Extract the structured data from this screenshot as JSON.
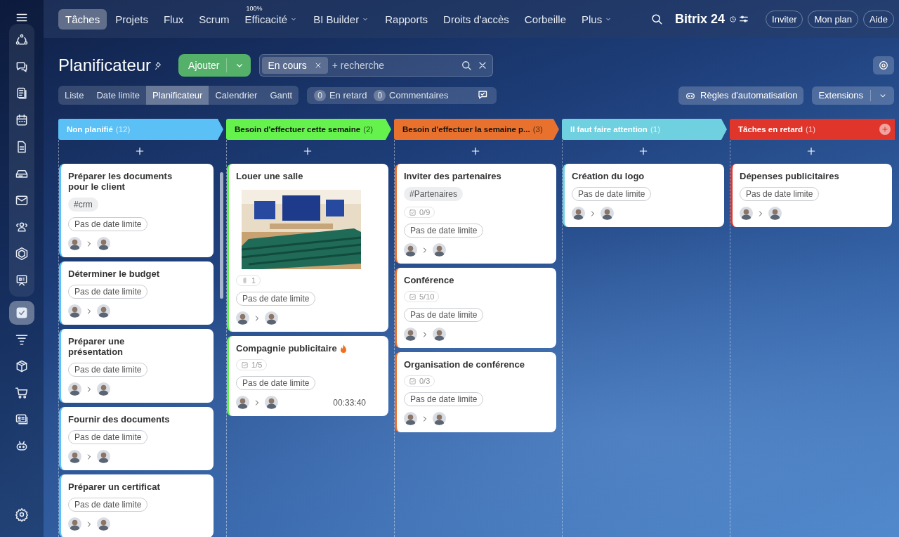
{
  "sidebar": {
    "items": [
      {
        "selected": false
      },
      {
        "selected": false
      },
      {
        "selected": false
      },
      {
        "selected": false
      },
      {
        "selected": false
      },
      {
        "selected": false
      },
      {
        "selected": false
      },
      {
        "selected": false
      },
      {
        "selected": false
      },
      {
        "selected": false
      },
      {
        "selected": true
      },
      {
        "selected": false
      },
      {
        "selected": false
      },
      {
        "selected": false
      },
      {
        "selected": false
      },
      {
        "selected": false
      }
    ]
  },
  "top_nav": {
    "items": [
      {
        "label": "Tâches",
        "selected": true,
        "dropdown": false
      },
      {
        "label": "Projets",
        "selected": false,
        "dropdown": false
      },
      {
        "label": "Flux",
        "selected": false,
        "dropdown": false
      },
      {
        "label": "Scrum",
        "selected": false,
        "dropdown": false
      },
      {
        "label": "Efficacité",
        "selected": false,
        "dropdown": true,
        "badge": "100%"
      },
      {
        "label": "BI Builder",
        "selected": false,
        "dropdown": true
      },
      {
        "label": "Rapports",
        "selected": false,
        "dropdown": false
      },
      {
        "label": "Droits d'accès",
        "selected": false,
        "dropdown": false
      },
      {
        "label": "Corbeille",
        "selected": false,
        "dropdown": false
      },
      {
        "label": "Plus",
        "selected": false,
        "dropdown": true
      }
    ],
    "logo": "Bitrix 24",
    "buttons": [
      "Inviter",
      "Mon plan",
      "Aide"
    ]
  },
  "header": {
    "title": "Planificateur",
    "add_button": "Ajouter",
    "search": {
      "chip": "En cours",
      "placeholder": "+ recherche"
    }
  },
  "view_tabs": [
    {
      "label": "Liste",
      "selected": false
    },
    {
      "label": "Date limite",
      "selected": false
    },
    {
      "label": "Planificateur",
      "selected": true
    },
    {
      "label": "Calendrier",
      "selected": false
    },
    {
      "label": "Gantt",
      "selected": false
    }
  ],
  "counters": [
    {
      "count": "0",
      "label": "En retard"
    },
    {
      "count": "0",
      "label": "Commentaires"
    }
  ],
  "automation_button": "Règles d'automatisation",
  "extensions_button": "Extensions",
  "columns": [
    {
      "title": "Non planifié",
      "count": "(12)",
      "color": "#5bc0f5",
      "dark_title": false,
      "add_button": false,
      "cards": [
        {
          "title": "Préparer les documents pour le client",
          "tag": "#crm",
          "hot": false,
          "deadline": "Pas de date limite"
        },
        {
          "title": "Déterminer le budget",
          "hot": false,
          "deadline": "Pas de date limite"
        },
        {
          "title": "Préparer une présentation",
          "hot": false,
          "deadline": "Pas de date limite"
        },
        {
          "title": "Fournir des documents",
          "hot": false,
          "deadline": "Pas de date limite"
        },
        {
          "title": "Préparer un certificat",
          "hot": false,
          "deadline": "Pas de date limite"
        }
      ]
    },
    {
      "title": "Besoin d'effectuer cette semaine",
      "count": "(2)",
      "color": "#66f24d",
      "dark_title": true,
      "add_button": false,
      "cards": [
        {
          "title": "Louer une salle",
          "attachments": "1",
          "hot": false,
          "deadline": "Pas de date limite"
        },
        {
          "title": "Compagnie publicitaire",
          "checklist": "1/5",
          "hot": true,
          "deadline": "Pas de date limite",
          "timer": "00:33:40"
        }
      ]
    },
    {
      "title": "Besoin d'effectuer la semaine p...",
      "count": "(3)",
      "color": "#e8712d",
      "dark_title": true,
      "add_button": false,
      "cards": [
        {
          "title": "Inviter des partenaires",
          "tag": "#Partenaires",
          "checklist": "0/9",
          "hot": false,
          "deadline": "Pas de date limite"
        },
        {
          "title": "Conférence",
          "checklist": "5/10",
          "hot": false,
          "deadline": "Pas de date limite"
        },
        {
          "title": "Organisation de conférence",
          "checklist": "0/3",
          "hot": false,
          "deadline": "Pas de date limite"
        }
      ]
    },
    {
      "title": "Il faut faire attention",
      "count": "(1)",
      "color": "#6fd0e0",
      "dark_title": false,
      "add_button": false,
      "cards": [
        {
          "title": "Création du logo",
          "hot": false,
          "deadline": "Pas de date limite"
        }
      ]
    },
    {
      "title": "Tâches en retard",
      "count": "(1)",
      "color": "#e0352b",
      "dark_title": false,
      "add_button": true,
      "cards": [
        {
          "title": "Dépenses publicitaires",
          "hot": false,
          "deadline": "Pas de date limite"
        }
      ]
    }
  ]
}
